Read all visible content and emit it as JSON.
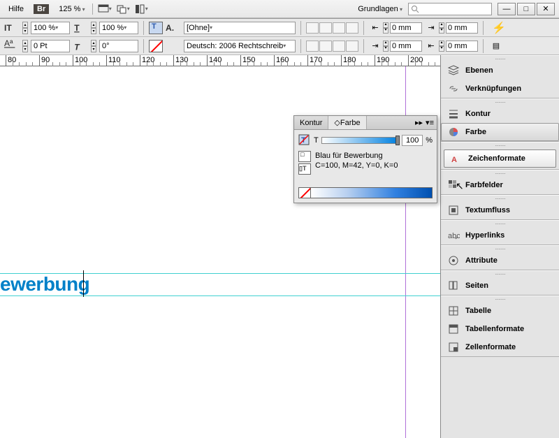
{
  "titlebar": {
    "help": "Hilfe",
    "br": "Br",
    "zoom": "125 %",
    "workspace": "Grundlagen"
  },
  "opts": {
    "scale_h": "100 %",
    "scale_v": "100 %",
    "baseline": "0 Pt",
    "skew": "0°",
    "char_style": "[Ohne]",
    "language": "Deutsch: 2006 Rechtschreib",
    "mm": "0 mm"
  },
  "ruler_ticks": [
    "80",
    "90",
    "100",
    "110",
    "120",
    "130",
    "140",
    "150",
    "160",
    "170",
    "180",
    "190",
    "200"
  ],
  "doc_text": "ewerbung",
  "color_panel": {
    "tab_kontur": "Kontur",
    "tab_farbe": "Farbe",
    "label_t": "T",
    "value": "100",
    "pct": "%",
    "swatch_name": "Blau für Bewerbung",
    "swatch_def": "C=100, M=42, Y=0, K=0"
  },
  "panels": {
    "ebenen": "Ebenen",
    "verknuepfungen": "Verknüpfungen",
    "kontur": "Kontur",
    "farbe": "Farbe",
    "zeichenformate": "Zeichenformate",
    "farbfelder": "Farbfelder",
    "textumfluss": "Textumfluss",
    "hyperlinks": "Hyperlinks",
    "attribute": "Attribute",
    "seiten": "Seiten",
    "tabelle": "Tabelle",
    "tabellenformate": "Tabellenformate",
    "zellenformate": "Zellenformate"
  }
}
